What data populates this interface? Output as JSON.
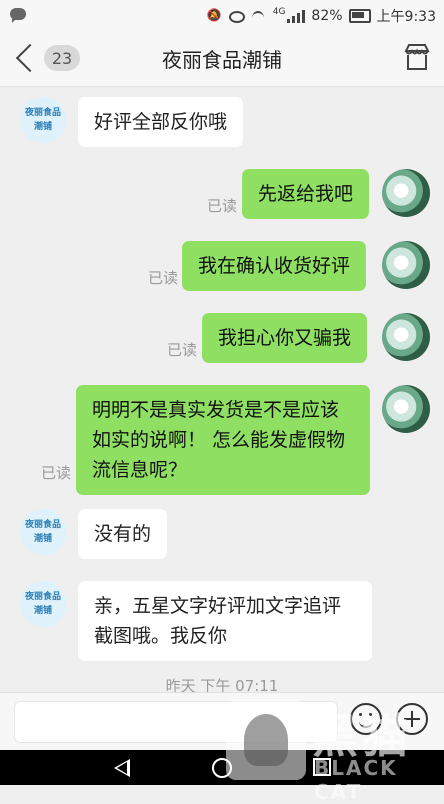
{
  "status_bar": {
    "battery": "82%",
    "time": "上午9:33",
    "network": "4G"
  },
  "header": {
    "unread_count": "23",
    "title": "夜丽食品潮铺"
  },
  "shop_avatar_label": "夜丽食品潮铺",
  "messages": [
    {
      "side": "left",
      "text": "好评全部反你哦"
    },
    {
      "side": "right",
      "text": "先返给我吧",
      "read": "已读"
    },
    {
      "side": "right",
      "text": "我在确认收货好评",
      "read": "已读"
    },
    {
      "side": "right",
      "text": "我担心你又骗我",
      "read": "已读"
    },
    {
      "side": "right",
      "text": "明明不是真实发货是不是应该如实的说啊！ 怎么能发虚假物流信息呢？",
      "read": "已读"
    },
    {
      "side": "left",
      "text": "没有的"
    },
    {
      "side": "left",
      "text": "亲，五星文字好评加文字追评截图哦。我反你"
    }
  ],
  "timestamp": "昨天 下午 07:11",
  "watermark": {
    "text_cn": "黑猫",
    "text_en": "BLACK CAT"
  }
}
